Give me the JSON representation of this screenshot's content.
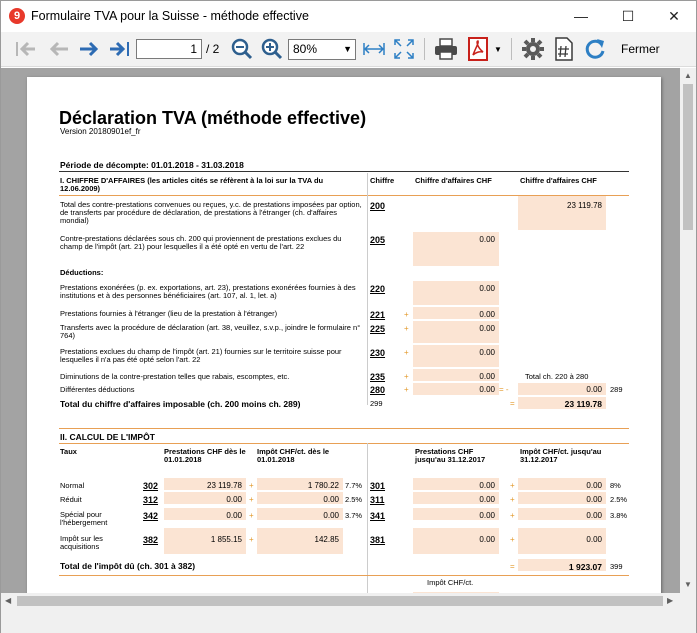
{
  "window": {
    "title": "Formulaire TVA pour la Suisse - méthode effective",
    "app_icon_glyph": "9",
    "minimize": "—",
    "maximize": "☐",
    "close": "✕"
  },
  "toolbar": {
    "page_current": "1",
    "page_total": "/ 2",
    "zoom": "80%",
    "close_label": "Fermer"
  },
  "document": {
    "title": "Déclaration TVA (méthode effective)",
    "version": "Version 20180901ef_fr",
    "period": "Période de décompte: 01.01.2018 - 31.03.2018",
    "section1": {
      "heading": "I. CHIFFRE D'AFFAIRES (les articles cités se réfèrent à la loi sur la TVA du 12.06.2009)",
      "col_chiffre": "Chiffre",
      "col_ca1": "Chiffre d'affaires CHF",
      "col_ca2": "Chiffre d'affaires CHF",
      "rows": [
        {
          "label": "Total des contre-prestations convenues ou reçues, y.c. de prestations imposées par option, de transferts par procédure de déclaration, de prestations à l'étranger (ch. d'affaires mondial)",
          "code": "200",
          "value2": "23 119.78"
        },
        {
          "label": "Contre-prestations déclarées sous ch. 200 qui proviennent de prestations exclues du champ de l'impôt (art. 21) pour lesquelles il a été opté en vertu de l'art. 22",
          "code": "205",
          "value1": "0.00"
        },
        {
          "label": "Déductions:"
        },
        {
          "label": "Prestations exonérées (p. ex. exportations, art. 23), prestations exonérées fournies à des institutions et à des personnes bénéficiaires (art. 107, al. 1, let. a)",
          "code": "220",
          "value1": "0.00"
        },
        {
          "label": "Prestations fournies à l'étranger (lieu de la prestation à l'étranger)",
          "code": "221",
          "op": "+",
          "value1": "0.00"
        },
        {
          "label": "Transferts avec la procédure de déclaration (art. 38, veuillez, s.v.p., joindre le formulaire n° 764)",
          "code": "225",
          "op": "+",
          "value1": "0.00"
        },
        {
          "label": "Prestations exclues du champ de l'impôt (art. 21) fournies sur le territoire suisse pour lesquelles il n'a pas été opté selon l'art. 22",
          "code": "230",
          "op": "+",
          "value1": "0.00"
        },
        {
          "label": "Diminutions de la contre-prestation telles que rabais, escomptes, etc.",
          "code": "235",
          "op": "+",
          "value1": "0.00",
          "note": "Total ch. 220 à 280"
        },
        {
          "label": "Différentes déductions",
          "code": "280",
          "op": "+",
          "value1": "0.00",
          "eq": "= -",
          "value2": "0.00",
          "extra": "289"
        },
        {
          "label": "Total du chiffre d'affaires imposable (ch. 200 moins ch. 289)",
          "code": "299",
          "eq": "=",
          "value2": "23 119.78"
        }
      ]
    },
    "section2": {
      "heading": "II. CALCUL DE L'IMPÔT",
      "col_taux": "Taux",
      "col_p1": "Prestations CHF dès le 01.01.2018",
      "col_i1": "Impôt CHF/ct. dès le 01.01.2018",
      "col_p2": "Prestations CHF jusqu'au 31.12.2017",
      "col_i2": "Impôt CHF/ct. jusqu'au 31.12.2017",
      "rows": [
        {
          "label": "Normal",
          "code1": "302",
          "p1": "23 119.78",
          "i1": "1 780.22",
          "rate1": "7.7%",
          "code2": "301",
          "p2": "0.00",
          "i2": "0.00",
          "rate2": "8%"
        },
        {
          "label": "Réduit",
          "code1": "312",
          "p1": "0.00",
          "i1": "0.00",
          "rate1": "2.5%",
          "code2": "311",
          "p2": "0.00",
          "i2": "0.00",
          "rate2": "2.5%"
        },
        {
          "label": "Spécial pour l'hébergement",
          "code1": "342",
          "p1": "0.00",
          "i1": "0.00",
          "rate1": "3.7%",
          "code2": "341",
          "p2": "0.00",
          "i2": "0.00",
          "rate2": "3.8%"
        },
        {
          "label": "Impôt sur les acquisitions",
          "code1": "382",
          "p1": "1 855.15",
          "i1": "142.85",
          "code2": "381",
          "p2": "0.00",
          "i2": "0.00"
        }
      ],
      "total_label": "Total de l'impôt dû (ch. 301 à 382)",
      "total_value": "1 923.07",
      "total_code": "399",
      "impot_label": "Impôt CHF/ct."
    }
  }
}
